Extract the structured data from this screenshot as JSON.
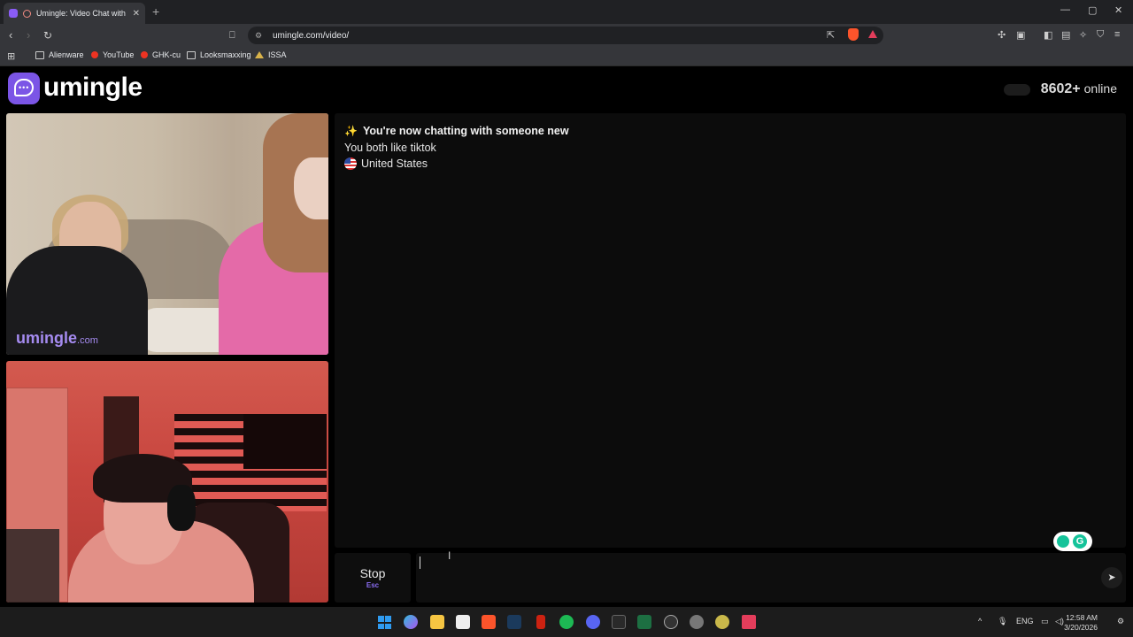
{
  "browser": {
    "tab_title": "Umingle: Video Chat with Strangers",
    "tab_close": "✕",
    "new_tab": "+",
    "window_controls": [
      "—",
      "▢",
      "✕"
    ],
    "url": "umingle.com/video/",
    "bookmarks": [
      {
        "label": "Alienware",
        "icon": "folder-icon"
      },
      {
        "label": "YouTube",
        "icon": "youtube-icon"
      },
      {
        "label": "GHK-cu",
        "icon": "ghk-icon"
      },
      {
        "label": "Looksmaxxing",
        "icon": "folder-icon"
      },
      {
        "label": "ISSA",
        "icon": "issa-icon"
      }
    ]
  },
  "site": {
    "logo_text": "umingle",
    "online_count": "8602+",
    "online_label": "online",
    "watermark_main": "umingle",
    "watermark_suffix": ".com"
  },
  "chat": {
    "status_message": "You're now chatting with someone new",
    "interest_message": "You both like tiktok",
    "country": "United States"
  },
  "controls": {
    "stop_label": "Stop",
    "stop_key": "Esc",
    "message_value": "",
    "send_icon": "send-icon"
  },
  "taskbar": {
    "language": "ENG",
    "time": "12:58 AM",
    "date": "3/20/2026"
  },
  "colors": {
    "brand_purple": "#7b55e6",
    "background": "#000000",
    "panel": "#0c0c0c"
  }
}
